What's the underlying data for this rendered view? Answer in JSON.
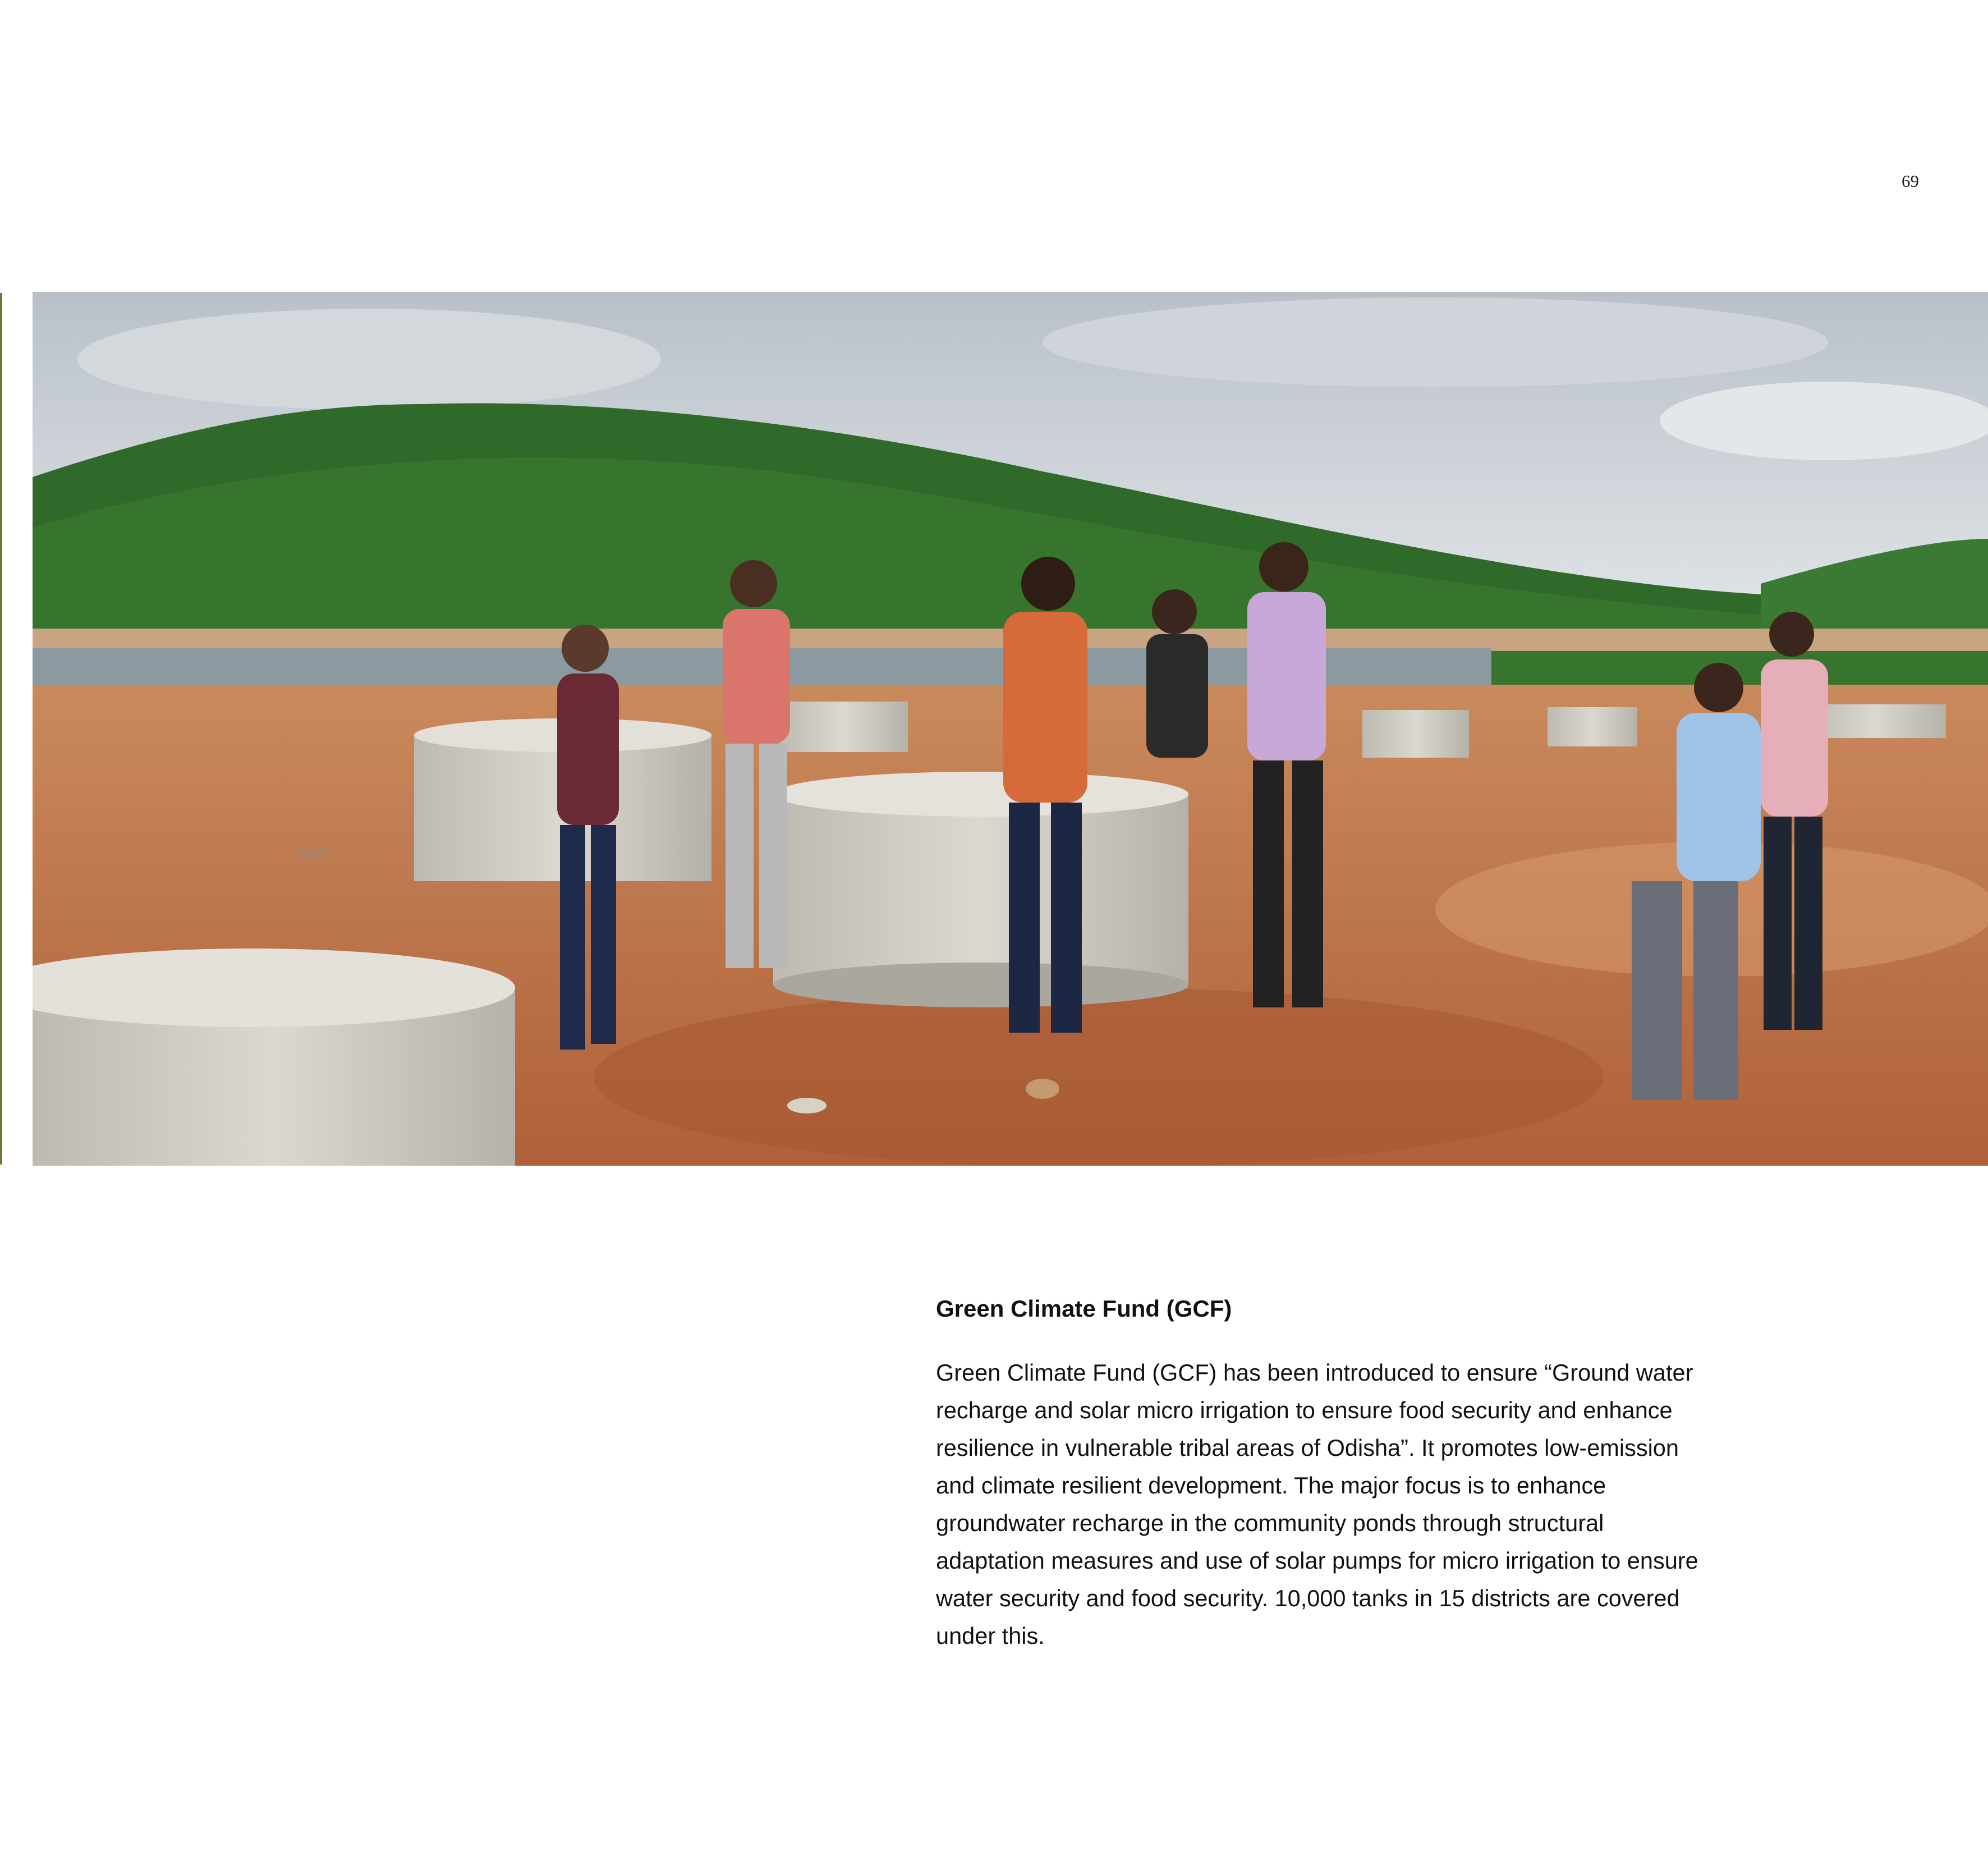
{
  "page": {
    "number": "69"
  },
  "photo": {
    "icon": "photo-field-inspection"
  },
  "section": {
    "heading": "Green Climate Fund (GCF)",
    "body": "Green Climate Fund (GCF) has been introduced to ensure “Ground water recharge and solar micro irrigation to ensure food security and enhance resilience in vulnerable tribal areas of Odisha”. It promotes low-emission and climate resilient development. The major focus is to enhance groundwater recharge in the community ponds through structural adaptation measures and use of solar pumps for micro irrigation to ensure water security and food security. 10,000 tanks in 15 districts are covered under this."
  },
  "colors": {
    "sky": "#c9cfd6",
    "hill": "#2f6a2a",
    "soil": "#c0703f",
    "water": "#8a9aa0",
    "concrete": "#cfcdc4"
  }
}
